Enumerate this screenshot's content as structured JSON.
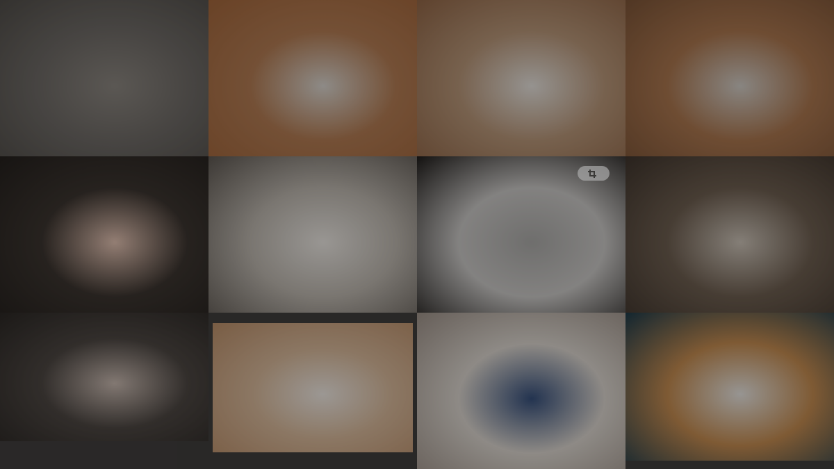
{
  "overlay": {
    "main_text": "",
    "sub_text_1": "",
    "sub_text_2": ""
  },
  "tiles": [
    {
      "name": "cat-photo-calico-on-rug",
      "colors": [
        "#6e6a66",
        "#8a857f",
        "#4f4c48"
      ]
    },
    {
      "name": "cat-photo-two-orange-cats-bed",
      "colors": [
        "#b07a52",
        "#d7d2cc",
        "#a0653b"
      ]
    },
    {
      "name": "cat-photo-orange-white-closeup",
      "colors": [
        "#b59477",
        "#e3dfda",
        "#8f6546"
      ]
    },
    {
      "name": "cat-photo-orange-cat-blanket",
      "colors": [
        "#a8754e",
        "#cfcac4",
        "#7a5337"
      ]
    },
    {
      "name": "cat-photo-calico-hand",
      "colors": [
        "#3b342f",
        "#e0c0b0",
        "#24201d"
      ]
    },
    {
      "name": "cat-photo-cat-legs-carpet",
      "colors": [
        "#b9b3ab",
        "#e8e4df",
        "#5c5650"
      ]
    },
    {
      "name": "cat-photo-black-cat-window",
      "colors": [
        "#c7c5c3",
        "#a9a8a6",
        "#1e1b19"
      ]
    },
    {
      "name": "cat-photo-tabby-floor",
      "colors": [
        "#6c5d4f",
        "#c9c0b5",
        "#3e342c"
      ]
    },
    {
      "name": "cat-photo-calico-cat-bed",
      "colors": [
        "#4c4642",
        "#c6b7ae",
        "#2b2724"
      ]
    },
    {
      "name": "cat-photo-cream-cat-sitting",
      "colors": [
        "#d4b597",
        "#ece6e0",
        "#b88d68"
      ]
    },
    {
      "name": "cat-photo-white-tabby-blanket",
      "colors": [
        "#d8d2cb",
        "#364f7a",
        "#9b8f86"
      ]
    },
    {
      "name": "cat-photo-orange-cat-lying",
      "colors": [
        "#c0894f",
        "#e5e2de",
        "#1c3a4a"
      ]
    }
  ],
  "crop_icon": "crop-icon",
  "colors": {
    "shade": "#000000",
    "text": "#e8e2df",
    "accent_text": "#e6c8d0"
  }
}
